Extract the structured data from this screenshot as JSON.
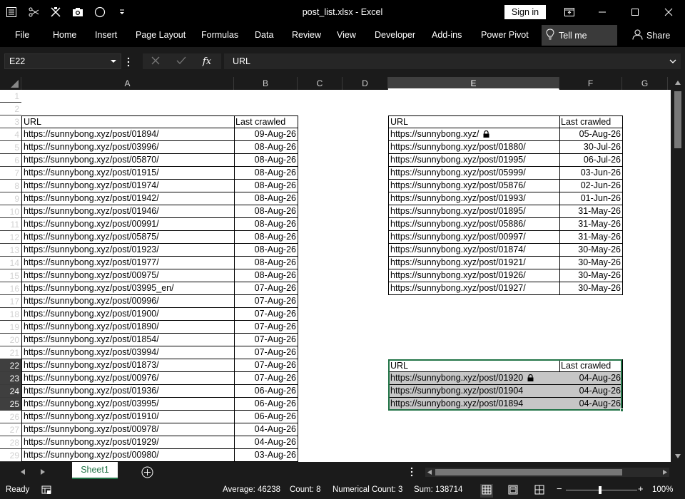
{
  "window": {
    "title": "post_list.xlsx  -  Excel",
    "sign_in": "Sign in"
  },
  "ribbon": {
    "tabs": [
      "File",
      "Home",
      "Insert",
      "Page Layout",
      "Formulas",
      "Data",
      "Review",
      "View",
      "Developer",
      "Add-ins",
      "Power Pivot"
    ],
    "tell_me": "Tell me",
    "share": "Share"
  },
  "formula_bar": {
    "name_box": "E22",
    "fx": "fx",
    "content": "URL"
  },
  "columns": [
    "A",
    "B",
    "C",
    "D",
    "E",
    "F",
    "G"
  ],
  "selected_column": "E",
  "rows": [
    "1",
    "2",
    "3",
    "4",
    "5",
    "6",
    "7",
    "8",
    "9",
    "10",
    "11",
    "12",
    "13",
    "14",
    "15",
    "16",
    "17",
    "18",
    "19",
    "20",
    "21",
    "22",
    "23",
    "24",
    "25",
    "26",
    "27",
    "28",
    "29"
  ],
  "table1": {
    "headers": [
      "URL",
      "Last crawled"
    ],
    "rows": [
      [
        "https://sunnybong.xyz/post/01894/",
        "09-Aug-26"
      ],
      [
        "https://sunnybong.xyz/post/03996/",
        "08-Aug-26"
      ],
      [
        "https://sunnybong.xyz/post/05870/",
        "08-Aug-26"
      ],
      [
        "https://sunnybong.xyz/post/01915/",
        "08-Aug-26"
      ],
      [
        "https://sunnybong.xyz/post/01974/",
        "08-Aug-26"
      ],
      [
        "https://sunnybong.xyz/post/01942/",
        "08-Aug-26"
      ],
      [
        "https://sunnybong.xyz/post/01946/",
        "08-Aug-26"
      ],
      [
        "https://sunnybong.xyz/post/00991/",
        "08-Aug-26"
      ],
      [
        "https://sunnybong.xyz/post/05875/",
        "08-Aug-26"
      ],
      [
        "https://sunnybong.xyz/post/01923/",
        "08-Aug-26"
      ],
      [
        "https://sunnybong.xyz/post/01977/",
        "08-Aug-26"
      ],
      [
        "https://sunnybong.xyz/post/00975/",
        "08-Aug-26"
      ],
      [
        "https://sunnybong.xyz/post/03995_en/",
        "07-Aug-26"
      ],
      [
        "https://sunnybong.xyz/post/00996/",
        "07-Aug-26"
      ],
      [
        "https://sunnybong.xyz/post/01900/",
        "07-Aug-26"
      ],
      [
        "https://sunnybong.xyz/post/01890/",
        "07-Aug-26"
      ],
      [
        "https://sunnybong.xyz/post/01854/",
        "07-Aug-26"
      ],
      [
        "https://sunnybong.xyz/post/03994/",
        "07-Aug-26"
      ],
      [
        "https://sunnybong.xyz/post/01873/",
        "07-Aug-26"
      ],
      [
        "https://sunnybong.xyz/post/00976/",
        "07-Aug-26"
      ],
      [
        "https://sunnybong.xyz/post/01936/",
        "06-Aug-26"
      ],
      [
        "https://sunnybong.xyz/post/03995/",
        "06-Aug-26"
      ],
      [
        "https://sunnybong.xyz/post/01910/",
        "06-Aug-26"
      ],
      [
        "https://sunnybong.xyz/post/00978/",
        "04-Aug-26"
      ],
      [
        "https://sunnybong.xyz/post/01929/",
        "04-Aug-26"
      ],
      [
        "https://sunnybong.xyz/post/00980/",
        "03-Aug-26"
      ]
    ]
  },
  "table2": {
    "headers": [
      "URL",
      "Last crawled"
    ],
    "rows": [
      [
        "https://sunnybong.xyz/",
        "05-Aug-26"
      ],
      [
        "https://sunnybong.xyz/post/01880/",
        "30-Jul-26"
      ],
      [
        "https://sunnybong.xyz/post/01995/",
        "06-Jul-26"
      ],
      [
        "https://sunnybong.xyz/post/05999/",
        "03-Jun-26"
      ],
      [
        "https://sunnybong.xyz/post/05876/",
        "02-Jun-26"
      ],
      [
        "https://sunnybong.xyz/post/01993/",
        "01-Jun-26"
      ],
      [
        "https://sunnybong.xyz/post/01895/",
        "31-May-26"
      ],
      [
        "https://sunnybong.xyz/post/05886/",
        "31-May-26"
      ],
      [
        "https://sunnybong.xyz/post/00997/",
        "31-May-26"
      ],
      [
        "https://sunnybong.xyz/post/01874/",
        "30-May-26"
      ],
      [
        "https://sunnybong.xyz/post/01921/",
        "30-May-26"
      ],
      [
        "https://sunnybong.xyz/post/01926/",
        "30-May-26"
      ],
      [
        "https://sunnybong.xyz/post/01927/",
        "30-May-26"
      ]
    ],
    "lock_row": 0
  },
  "table3": {
    "headers": [
      "URL",
      "Last crawled"
    ],
    "rows": [
      [
        "https://sunnybong.xyz/post/01920",
        "04-Aug-26"
      ],
      [
        "https://sunnybong.xyz/post/01904",
        "04-Aug-26"
      ],
      [
        "https://sunnybong.xyz/post/01894",
        "04-Aug-26"
      ]
    ],
    "lock_row": 0
  },
  "sheets": [
    "Sheet1"
  ],
  "status": {
    "ready": "Ready",
    "average": "Average: 46238",
    "count": "Count: 8",
    "numerical_count": "Numerical Count: 3",
    "sum": "Sum: 138714",
    "zoom": "100%"
  }
}
